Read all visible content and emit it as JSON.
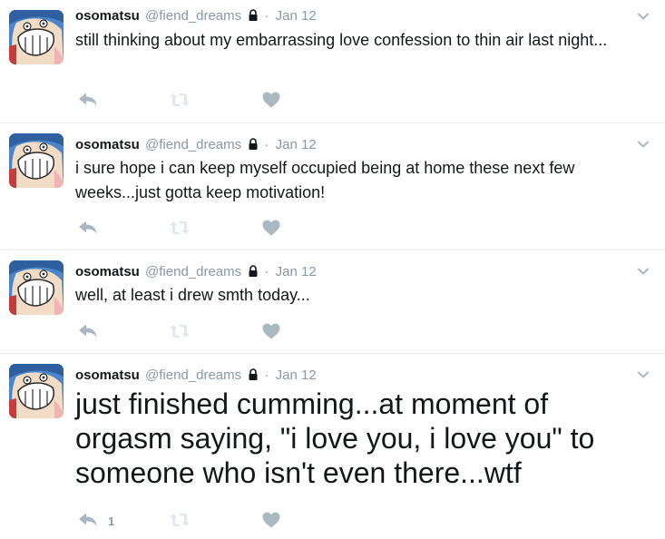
{
  "tweets": [
    {
      "name": "osomatsu",
      "handle": "@fiend_dreams",
      "time": "Jan 12",
      "text": "still thinking about my embarrassing love confession to thin air last night...",
      "reply_count": ""
    },
    {
      "name": "osomatsu",
      "handle": "@fiend_dreams",
      "time": "Jan 12",
      "text": "i sure hope i can keep myself occupied being at home these next few weeks...just gotta keep motivation!",
      "reply_count": ""
    },
    {
      "name": "osomatsu",
      "handle": "@fiend_dreams",
      "time": "Jan 12",
      "text": "well, at least i drew smth today...",
      "reply_count": ""
    },
    {
      "name": "osomatsu",
      "handle": "@fiend_dreams",
      "time": "Jan 12",
      "text": "just finished cumming...at moment of orgasm saying, \"i love you, i love you\" to someone who isn't even there...wtf",
      "reply_count": "1"
    }
  ],
  "separator": "·",
  "icons": {
    "lock": "lock-icon",
    "caret": "chevron-down-icon",
    "reply": "reply-icon",
    "retweet": "retweet-icon",
    "like": "heart-icon"
  },
  "colors": {
    "muted": "#8899a6",
    "icon_gray": "#aab8c2",
    "divider": "#e6ecf0",
    "text": "#14171a"
  }
}
